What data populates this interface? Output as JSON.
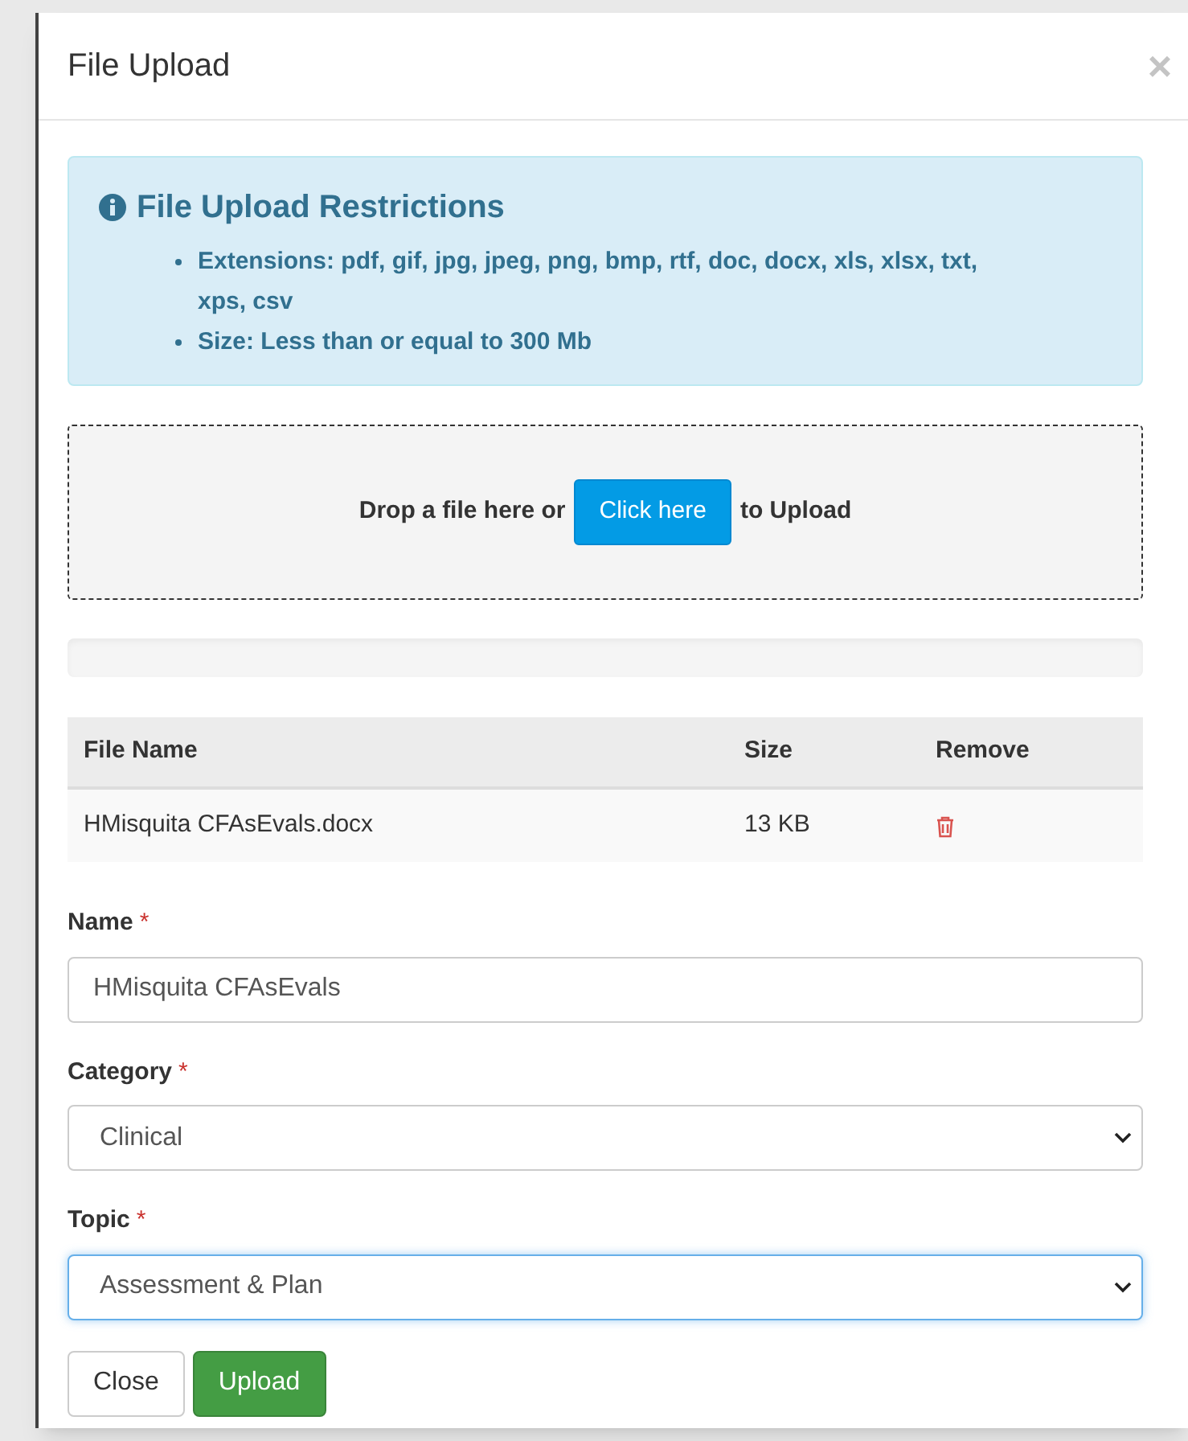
{
  "dialog": {
    "title": "File Upload",
    "close_glyph": "×"
  },
  "restrictions": {
    "title": "File Upload Restrictions",
    "items": [
      "Extensions: pdf, gif, jpg, jpeg, png, bmp, rtf, doc, docx, xls, xlsx, txt, xps, csv",
      "Size: Less than or equal to 300 Mb"
    ]
  },
  "dropzone": {
    "text_before": "Drop a file here or",
    "button": "Click here",
    "text_after": "to Upload"
  },
  "progress": {
    "level": 0
  },
  "table": {
    "columns": [
      "File Name",
      "Size",
      "Remove"
    ],
    "rows": [
      {
        "file_name": "HMisquita CFAsEvals.docx",
        "size": "13 KB"
      }
    ]
  },
  "fields": [
    {
      "kind": "text",
      "label": "Name",
      "required_mark": "*",
      "value": "HMisquita CFAsEvals",
      "focused": false
    },
    {
      "kind": "select",
      "label": "Category",
      "required_mark": "*",
      "value": "Clinical",
      "focused": false
    },
    {
      "kind": "select",
      "label": "Topic",
      "required_mark": "*",
      "value": "Assessment & Plan",
      "focused": true
    }
  ],
  "buttons": [
    {
      "label": "Close",
      "kind": "default"
    },
    {
      "label": "Upload",
      "kind": "success"
    }
  ]
}
